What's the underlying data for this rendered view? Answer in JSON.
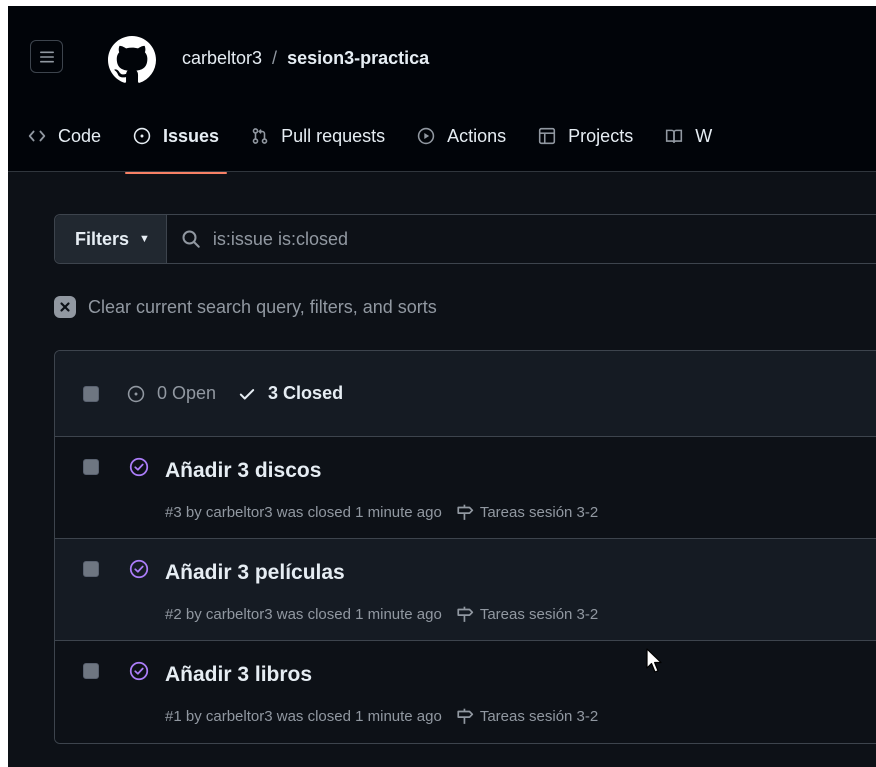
{
  "repo": {
    "owner": "carbeltor3",
    "separator": "/",
    "name": "sesion3-practica"
  },
  "tabs": [
    {
      "label": "Code",
      "icon": "code-icon"
    },
    {
      "label": "Issues",
      "icon": "issue-opened-icon"
    },
    {
      "label": "Pull requests",
      "icon": "git-pull-request-icon"
    },
    {
      "label": "Actions",
      "icon": "play-icon"
    },
    {
      "label": "Projects",
      "icon": "table-icon"
    },
    {
      "label": "W",
      "icon": "book-icon"
    }
  ],
  "filters": {
    "label": "Filters",
    "query": "is:issue is:closed"
  },
  "clear": {
    "label": "Clear current search query, filters, and sorts"
  },
  "states": {
    "open": "0 Open",
    "closed": "3 Closed"
  },
  "issues": [
    {
      "title": "Añadir 3 discos",
      "meta": "#3 by carbeltor3 was closed 1 minute ago",
      "milestone": "Tareas sesión 3-2"
    },
    {
      "title": "Añadir 3 películas",
      "meta": "#2 by carbeltor3 was closed 1 minute ago",
      "milestone": "Tareas sesión 3-2"
    },
    {
      "title": "Añadir 3 libros",
      "meta": "#1 by carbeltor3 was closed 1 minute ago",
      "milestone": "Tareas sesión 3-2"
    }
  ],
  "colors": {
    "background": "#0d1117",
    "header": "#010409",
    "accent": "#f78166",
    "closed_purple": "#ab7df8",
    "muted": "#9198a1"
  }
}
